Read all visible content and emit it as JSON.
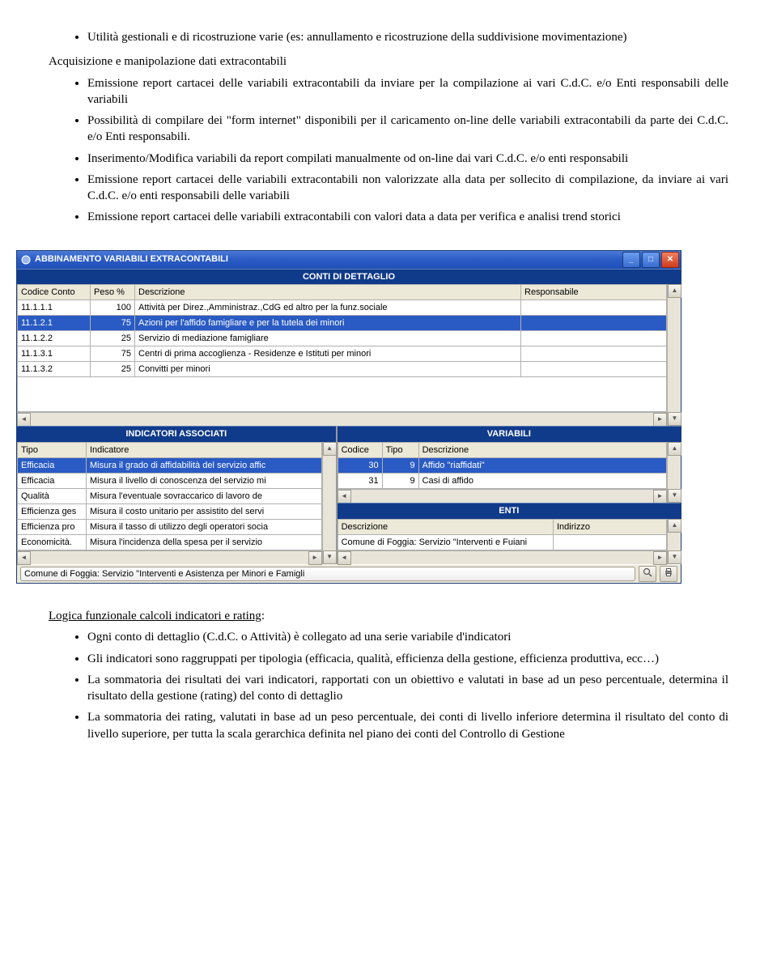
{
  "doc": {
    "bullets_top": [
      "Utilità gestionali e di ricostruzione varie (es: annullamento e ricostruzione della suddivisione movimentazione)"
    ],
    "section1_title": "Acquisizione e manipolazione dati extracontabili",
    "bullets_section1": [
      "Emissione report cartacei delle variabili extracontabili da inviare per la compilazione ai vari C.d.C. e/o Enti responsabili delle variabili",
      "Possibilità di compilare dei \"form internet\" disponibili per il caricamento on-line delle variabili extracontabili da parte dei C.d.C. e/o Enti responsabili.",
      "Inserimento/Modifica variabili da report compilati manualmente od on-line dai vari C.d.C. e/o enti responsabili",
      "Emissione report cartacei delle variabili extracontabili non valorizzate alla data per sollecito di compilazione, da inviare ai vari C.d.C. e/o enti responsabili delle variabili",
      "Emissione report cartacei delle variabili extracontabili con valori data a data per verifica e analisi trend storici"
    ],
    "section2_title": "Logica funzionale calcoli indicatori e rating",
    "bullets_section2": [
      "Ogni conto di dettaglio (C.d.C. o Attività) è collegato ad una serie variabile d'indicatori",
      "Gli indicatori sono raggruppati per tipologia (efficacia, qualità, efficienza della gestione, efficienza produttiva, ecc…)",
      "La sommatoria dei risultati dei vari indicatori, rapportati con un obiettivo e valutati in base ad un peso percentuale, determina il risultato della gestione (rating) del conto di dettaglio",
      "La sommatoria dei rating, valutati in base ad un peso percentuale, dei conti di livello inferiore determina il risultato del conto di livello superiore, per tutta la scala gerarchica definita nel piano dei conti del Controllo di Gestione"
    ]
  },
  "app": {
    "title": "ABBINAMENTO VARIABILI EXTRACONTABILI",
    "panels": {
      "conti": "CONTI DI DETTAGLIO",
      "indicatori": "INDICATORI ASSOCIATI",
      "variabili": "VARIABILI",
      "enti": "ENTI"
    },
    "conti_headers": {
      "codice": "Codice Conto",
      "peso": "Peso %",
      "desc": "Descrizione",
      "resp": "Responsabile"
    },
    "conti_rows": [
      {
        "codice": "11.1.1.1",
        "peso": "100",
        "desc": "Attività per Direz.,Amministraz.,CdG ed altro per la funz.sociale",
        "resp": ""
      },
      {
        "codice": "11.1.2.1",
        "peso": "75",
        "desc": "Azioni per l'affido famigliare e per la tutela dei minori",
        "resp": ""
      },
      {
        "codice": "11.1.2.2",
        "peso": "25",
        "desc": "Servizio di mediazione famigliare",
        "resp": ""
      },
      {
        "codice": "11.1.3.1",
        "peso": "75",
        "desc": "Centri di prima accoglienza - Residenze e Istituti per minori",
        "resp": ""
      },
      {
        "codice": "11.1.3.2",
        "peso": "25",
        "desc": "Convitti per minori",
        "resp": ""
      }
    ],
    "conti_selected": 1,
    "indicatori_headers": {
      "tipo": "Tipo",
      "ind": "Indicatore"
    },
    "indicatori_rows": [
      {
        "tipo": "Efficacia",
        "ind": "Misura il grado di affidabilità del servizio affic"
      },
      {
        "tipo": "Efficacia",
        "ind": "Misura il livello di conoscenza del servizio mi"
      },
      {
        "tipo": "Qualità",
        "ind": "Misura l'eventuale sovraccarico di lavoro de"
      },
      {
        "tipo": "Efficienza ges",
        "ind": "Misura il costo unitario per assistito del servi"
      },
      {
        "tipo": "Efficienza pro",
        "ind": "Misura il tasso di utilizzo degli operatori socia"
      },
      {
        "tipo": "Economicità.",
        "ind": "Misura l'incidenza della spesa per il servizio"
      }
    ],
    "indicatori_selected": 0,
    "variabili_headers": {
      "codice": "Codice",
      "tipo": "Tipo",
      "desc": "Descrizione"
    },
    "variabili_rows": [
      {
        "codice": "30",
        "tipo": "9",
        "desc": "Affido \"riaffidati\""
      },
      {
        "codice": "31",
        "tipo": "9",
        "desc": "Casi di affido"
      }
    ],
    "variabili_selected": 0,
    "enti_headers": {
      "desc": "Descrizione",
      "ind": "Indirizzo"
    },
    "enti_rows": [
      {
        "desc": "Comune di Foggia: Servizio \"Interventi e Fuiani",
        "ind": ""
      }
    ],
    "status_text": "Comune di Foggia:   Servizio \"Interventi e Asistenza per Minori e Famigli"
  }
}
